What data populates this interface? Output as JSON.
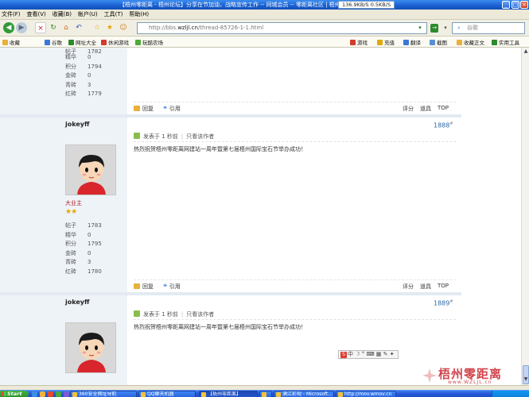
{
  "window": {
    "title": "【梧州零距离 - 梧州论坛】分享在节加油，战略宣传工作 -- 同城会员 -- 零距离社区 | 梧州论坛 ...",
    "speed": "136.9KB/S   0.5KB/S"
  },
  "menu": [
    "文件(F)",
    "查看(V)",
    "收藏(B)",
    "帐户(U)",
    "工具(T)",
    "帮助(H)"
  ],
  "address": {
    "prefix": "http://bbs.",
    "host": "wzljl.cn",
    "path": "/thread-85726-1-1.html"
  },
  "search": {
    "placeholder": "谷歌"
  },
  "favorites": {
    "left": [
      "收藏",
      "谷歌",
      "网址大全",
      "休闲游戏",
      "玩酷农场"
    ],
    "right": [
      "游戏",
      "充值",
      "翻译",
      "截图",
      "收藏正文",
      "实用工具"
    ]
  },
  "labels": {
    "posts": "帖子",
    "essence": "精华",
    "points": "积分",
    "gold": "金砖",
    "green": "青砖",
    "red": "红砖",
    "reply": "回复",
    "quote": "引用",
    "rate": "评分",
    "tools": "道具",
    "top": "TOP",
    "posted": "发表于",
    "ago": "1 秒前",
    "author_only": "只看该作者"
  },
  "post0": {
    "stats": {
      "posts": "1782",
      "essence": "0",
      "points": "1794",
      "gold": "0",
      "green": "3",
      "red": "1779"
    }
  },
  "post1": {
    "username": "jokeyff",
    "floor": "1888",
    "rank": "大业主",
    "stats": {
      "posts": "1783",
      "essence": "0",
      "points": "1795",
      "gold": "0",
      "green": "3",
      "red": "1780"
    },
    "content": "热烈祝贺梧州零距离网建站一周年暨第七届梧州国际宝石节举办成功！"
  },
  "post2": {
    "username": "jokeyff",
    "floor": "1889",
    "content": "热烈祝贺梧州零距离网建站一周年暨第七届梧州国际宝石节举办成功！"
  },
  "ime": {
    "label": "中"
  },
  "watermark": {
    "text": "梧州零距离",
    "url": "www.WZLJL.cn"
  },
  "taskbar": {
    "start": "Start",
    "tasks": [
      "360安全网址导航",
      "QQ聊天机器",
      "【梧州零距离】",
      "",
      "满江彩视 - Microsoft...",
      "http://mov.wmov.cn"
    ]
  },
  "colors": {
    "link": "#2b6aa8",
    "leftcol": "#eef3f8",
    "rank": "#b02020"
  }
}
